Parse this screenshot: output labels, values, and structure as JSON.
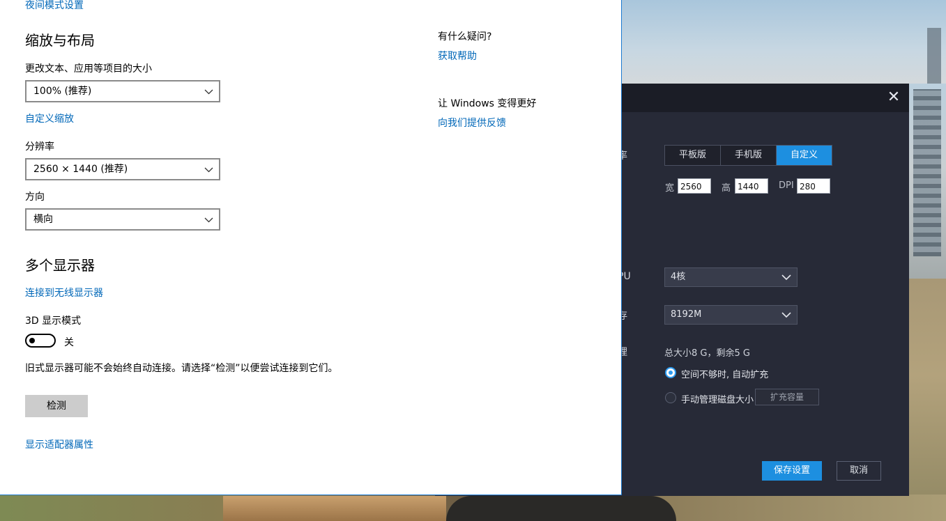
{
  "settings": {
    "night_mode_link": "夜间模式设置",
    "scale_layout_heading": "缩放与布局",
    "text_size_label": "更改文本、应用等项目的大小",
    "text_size_value": "100% (推荐)",
    "custom_scale_link": "自定义缩放",
    "resolution_label": "分辨率",
    "resolution_value": "2560 × 1440 (推荐)",
    "orientation_label": "方向",
    "orientation_value": "横向",
    "multi_display_heading": "多个显示器",
    "wireless_link": "连接到无线显示器",
    "mode3d_label": "3D 显示模式",
    "mode3d_state": "关",
    "legacy_note": "旧式显示器可能不会始终自动连接。请选择“检测”以便尝试连接到它们。",
    "detect_button": "检测",
    "adapter_link": "显示适配器属性",
    "help_question": "有什么疑问?",
    "help_link": "获取帮助",
    "improve_label": "让 Windows 变得更好",
    "feedback_link": "向我们提供反馈"
  },
  "emulator": {
    "close_glyph": "✕",
    "resolution_label_partial": "率",
    "presets": [
      "平板版",
      "手机版",
      "自定义"
    ],
    "active_preset": "自定义",
    "width_label": "宽",
    "width_value": "2560",
    "height_label": "高",
    "height_value": "1440",
    "dpi_label": "DPI",
    "dpi_value": "280",
    "cpu_label_partial": "PU",
    "cpu_value": "4核",
    "memory_label_partial": "存",
    "memory_value": "8192M",
    "disk_label_partial": "理",
    "disk_info": "总大小8 G，剩余5 G",
    "auto_expand_option": "空间不够时, 自动扩充",
    "manual_option": "手动管理磁盘大小",
    "expand_button": "扩充容量",
    "save_button": "保存设置",
    "cancel_button": "取消",
    "accent_color": "#1d8fe0"
  }
}
